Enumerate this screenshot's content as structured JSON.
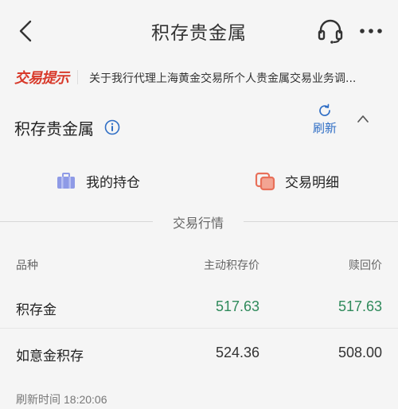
{
  "header": {
    "title": "积存贵金属",
    "back_icon": "chevron-left-icon",
    "service_icon": "headset-icon",
    "more_icon": "more-dots-icon"
  },
  "notice": {
    "logo": "交易提示",
    "text": "关于我行代理上海黄金交易所个人贵金属交易业务调..."
  },
  "section": {
    "title": "积存贵金属",
    "info_icon": "info-icon",
    "refresh_label": "刷新",
    "collapse_icon": "chevron-up-icon"
  },
  "entries": [
    {
      "label": "我的持仓",
      "icon": "briefcase-icon"
    },
    {
      "label": "交易明细",
      "icon": "documents-icon"
    }
  ],
  "market": {
    "divider_label": "交易行情",
    "headers": [
      "品种",
      "主动积存价",
      "赎回价"
    ],
    "rows": [
      {
        "name": "积存金",
        "buy": "517.63",
        "sell": "517.63",
        "color": "#2f8a5b"
      },
      {
        "name": "如意金积存",
        "buy": "524.36",
        "sell": "508.00",
        "color": "#333333"
      }
    ]
  },
  "refresh_time": {
    "label": "刷新时间",
    "value": "18:20:06"
  },
  "colors": {
    "accent_blue": "#2f6ec5",
    "brand_red": "#d83a2b",
    "price_green": "#2f8a5b",
    "background": "#f5f5f5"
  }
}
